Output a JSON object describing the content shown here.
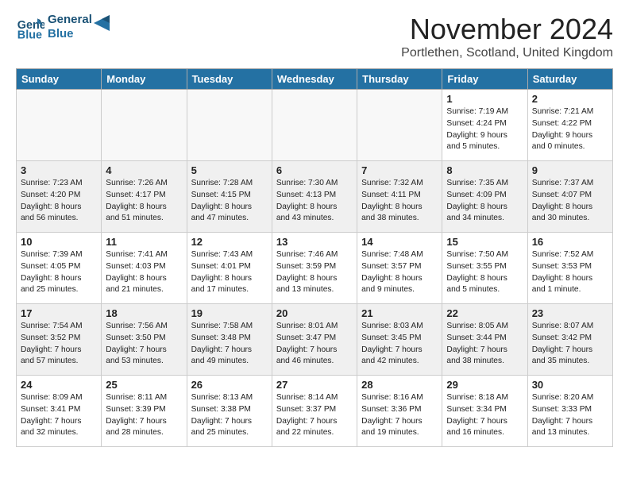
{
  "header": {
    "logo_line1": "General",
    "logo_line2": "Blue",
    "month": "November 2024",
    "location": "Portlethen, Scotland, United Kingdom"
  },
  "weekdays": [
    "Sunday",
    "Monday",
    "Tuesday",
    "Wednesday",
    "Thursday",
    "Friday",
    "Saturday"
  ],
  "weeks": [
    [
      {
        "day": "",
        "info": "",
        "empty": true
      },
      {
        "day": "",
        "info": "",
        "empty": true
      },
      {
        "day": "",
        "info": "",
        "empty": true
      },
      {
        "day": "",
        "info": "",
        "empty": true
      },
      {
        "day": "",
        "info": "",
        "empty": true
      },
      {
        "day": "1",
        "info": "Sunrise: 7:19 AM\nSunset: 4:24 PM\nDaylight: 9 hours\nand 5 minutes.",
        "empty": false
      },
      {
        "day": "2",
        "info": "Sunrise: 7:21 AM\nSunset: 4:22 PM\nDaylight: 9 hours\nand 0 minutes.",
        "empty": false
      }
    ],
    [
      {
        "day": "3",
        "info": "Sunrise: 7:23 AM\nSunset: 4:20 PM\nDaylight: 8 hours\nand 56 minutes.",
        "empty": false
      },
      {
        "day": "4",
        "info": "Sunrise: 7:26 AM\nSunset: 4:17 PM\nDaylight: 8 hours\nand 51 minutes.",
        "empty": false
      },
      {
        "day": "5",
        "info": "Sunrise: 7:28 AM\nSunset: 4:15 PM\nDaylight: 8 hours\nand 47 minutes.",
        "empty": false
      },
      {
        "day": "6",
        "info": "Sunrise: 7:30 AM\nSunset: 4:13 PM\nDaylight: 8 hours\nand 43 minutes.",
        "empty": false
      },
      {
        "day": "7",
        "info": "Sunrise: 7:32 AM\nSunset: 4:11 PM\nDaylight: 8 hours\nand 38 minutes.",
        "empty": false
      },
      {
        "day": "8",
        "info": "Sunrise: 7:35 AM\nSunset: 4:09 PM\nDaylight: 8 hours\nand 34 minutes.",
        "empty": false
      },
      {
        "day": "9",
        "info": "Sunrise: 7:37 AM\nSunset: 4:07 PM\nDaylight: 8 hours\nand 30 minutes.",
        "empty": false
      }
    ],
    [
      {
        "day": "10",
        "info": "Sunrise: 7:39 AM\nSunset: 4:05 PM\nDaylight: 8 hours\nand 25 minutes.",
        "empty": false
      },
      {
        "day": "11",
        "info": "Sunrise: 7:41 AM\nSunset: 4:03 PM\nDaylight: 8 hours\nand 21 minutes.",
        "empty": false
      },
      {
        "day": "12",
        "info": "Sunrise: 7:43 AM\nSunset: 4:01 PM\nDaylight: 8 hours\nand 17 minutes.",
        "empty": false
      },
      {
        "day": "13",
        "info": "Sunrise: 7:46 AM\nSunset: 3:59 PM\nDaylight: 8 hours\nand 13 minutes.",
        "empty": false
      },
      {
        "day": "14",
        "info": "Sunrise: 7:48 AM\nSunset: 3:57 PM\nDaylight: 8 hours\nand 9 minutes.",
        "empty": false
      },
      {
        "day": "15",
        "info": "Sunrise: 7:50 AM\nSunset: 3:55 PM\nDaylight: 8 hours\nand 5 minutes.",
        "empty": false
      },
      {
        "day": "16",
        "info": "Sunrise: 7:52 AM\nSunset: 3:53 PM\nDaylight: 8 hours\nand 1 minute.",
        "empty": false
      }
    ],
    [
      {
        "day": "17",
        "info": "Sunrise: 7:54 AM\nSunset: 3:52 PM\nDaylight: 7 hours\nand 57 minutes.",
        "empty": false
      },
      {
        "day": "18",
        "info": "Sunrise: 7:56 AM\nSunset: 3:50 PM\nDaylight: 7 hours\nand 53 minutes.",
        "empty": false
      },
      {
        "day": "19",
        "info": "Sunrise: 7:58 AM\nSunset: 3:48 PM\nDaylight: 7 hours\nand 49 minutes.",
        "empty": false
      },
      {
        "day": "20",
        "info": "Sunrise: 8:01 AM\nSunset: 3:47 PM\nDaylight: 7 hours\nand 46 minutes.",
        "empty": false
      },
      {
        "day": "21",
        "info": "Sunrise: 8:03 AM\nSunset: 3:45 PM\nDaylight: 7 hours\nand 42 minutes.",
        "empty": false
      },
      {
        "day": "22",
        "info": "Sunrise: 8:05 AM\nSunset: 3:44 PM\nDaylight: 7 hours\nand 38 minutes.",
        "empty": false
      },
      {
        "day": "23",
        "info": "Sunrise: 8:07 AM\nSunset: 3:42 PM\nDaylight: 7 hours\nand 35 minutes.",
        "empty": false
      }
    ],
    [
      {
        "day": "24",
        "info": "Sunrise: 8:09 AM\nSunset: 3:41 PM\nDaylight: 7 hours\nand 32 minutes.",
        "empty": false
      },
      {
        "day": "25",
        "info": "Sunrise: 8:11 AM\nSunset: 3:39 PM\nDaylight: 7 hours\nand 28 minutes.",
        "empty": false
      },
      {
        "day": "26",
        "info": "Sunrise: 8:13 AM\nSunset: 3:38 PM\nDaylight: 7 hours\nand 25 minutes.",
        "empty": false
      },
      {
        "day": "27",
        "info": "Sunrise: 8:14 AM\nSunset: 3:37 PM\nDaylight: 7 hours\nand 22 minutes.",
        "empty": false
      },
      {
        "day": "28",
        "info": "Sunrise: 8:16 AM\nSunset: 3:36 PM\nDaylight: 7 hours\nand 19 minutes.",
        "empty": false
      },
      {
        "day": "29",
        "info": "Sunrise: 8:18 AM\nSunset: 3:34 PM\nDaylight: 7 hours\nand 16 minutes.",
        "empty": false
      },
      {
        "day": "30",
        "info": "Sunrise: 8:20 AM\nSunset: 3:33 PM\nDaylight: 7 hours\nand 13 minutes.",
        "empty": false
      }
    ]
  ]
}
